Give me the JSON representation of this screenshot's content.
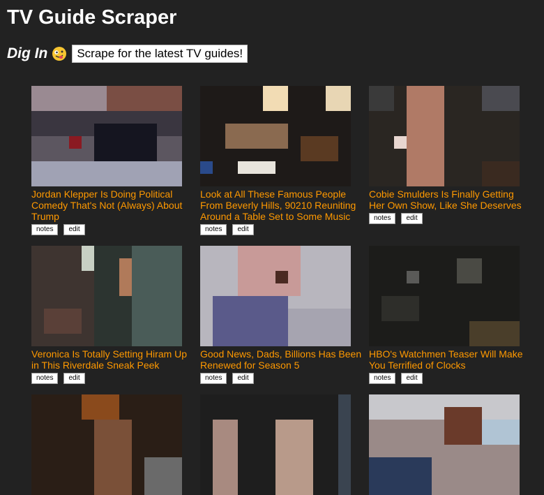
{
  "header": {
    "title": "TV Guide Scraper",
    "dig_in_label": "Dig In",
    "scrape_button": "Scrape for the latest TV guides!"
  },
  "colors": {
    "background": "#222222",
    "link": "#ff9900"
  },
  "icons": {
    "emoji": "zany-face-icon"
  },
  "articles": [
    {
      "title": "Jordan Klepper Is Doing Political Comedy That's Not (Always) About Trump",
      "notes": "notes",
      "edit": "edit"
    },
    {
      "title": "Look at All These Famous People From Beverly Hills, 90210 Reuniting Around a Table Set to Some Music",
      "notes": "notes",
      "edit": "edit"
    },
    {
      "title": "Cobie Smulders Is Finally Getting Her Own Show, Like She Deserves",
      "notes": "notes",
      "edit": "edit"
    },
    {
      "title": "Veronica Is Totally Setting Hiram Up in This Riverdale Sneak Peek",
      "notes": "notes",
      "edit": "edit"
    },
    {
      "title": "Good News, Dads, Billions Has Been Renewed for Season 5",
      "notes": "notes",
      "edit": "edit"
    },
    {
      "title": "HBO's Watchmen Teaser Will Make You Terrified of Clocks",
      "notes": "notes",
      "edit": "edit"
    },
    {
      "title": "",
      "notes": "",
      "edit": ""
    },
    {
      "title": "",
      "notes": "",
      "edit": ""
    },
    {
      "title": "",
      "notes": "",
      "edit": ""
    }
  ]
}
